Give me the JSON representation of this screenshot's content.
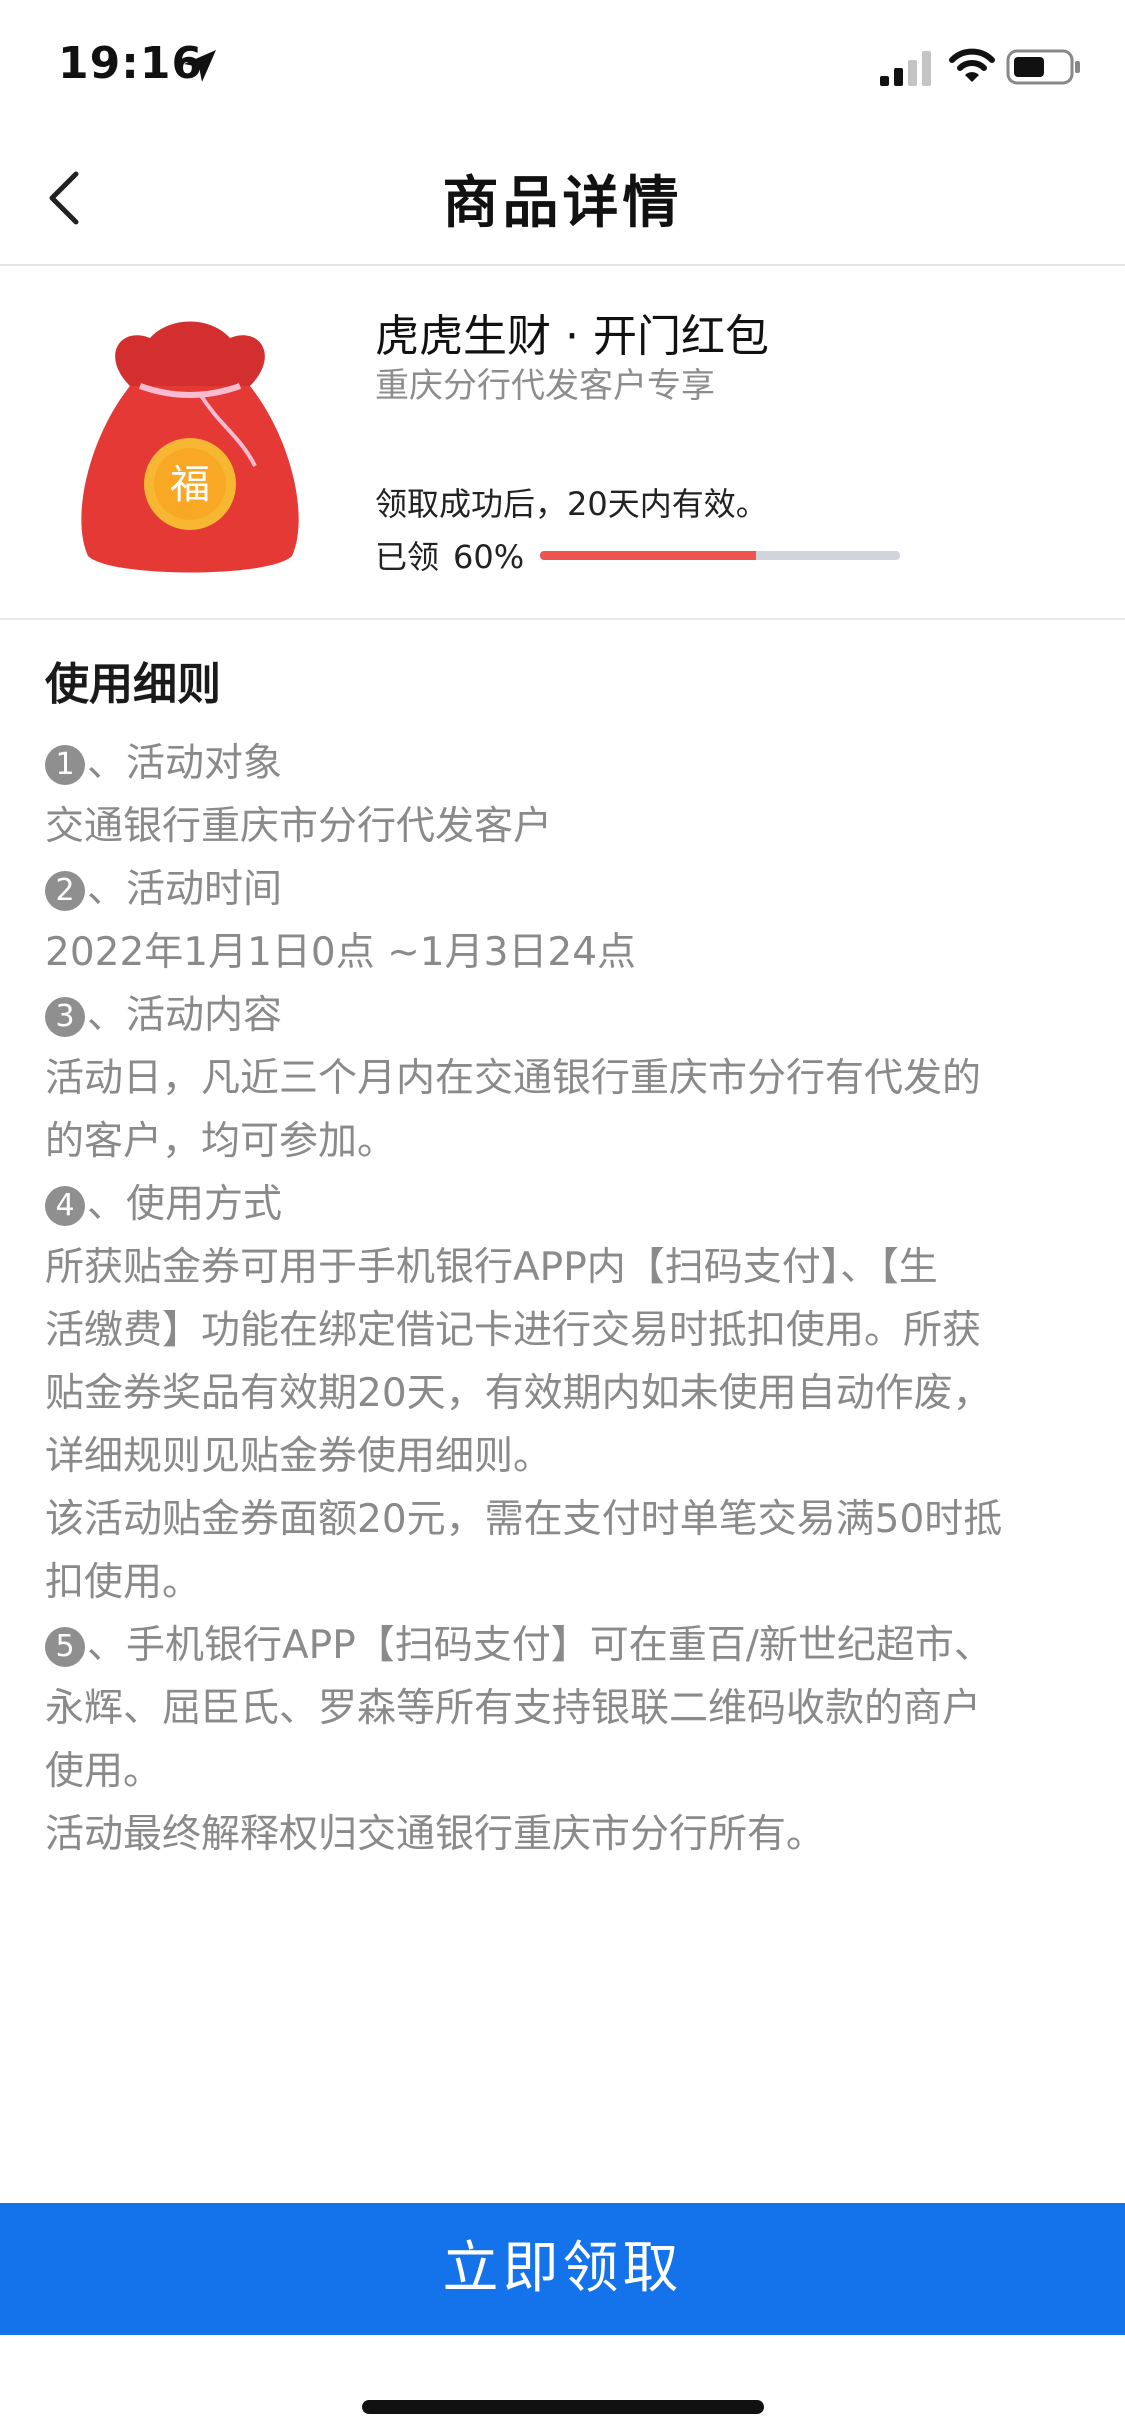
{
  "status_bar": {
    "time": "19:16"
  },
  "nav": {
    "title": "商品详情"
  },
  "product": {
    "name": "虎虎生财 · 开门红包",
    "subtitle": "重庆分行代发客户专享",
    "validity": "领取成功后，20天内有效。",
    "claimed_label": "已领",
    "claimed_percent_text": "60%",
    "claimed_fraction": 0.6,
    "bag_label": "福"
  },
  "rules": {
    "title": "使用细则",
    "lines": [
      "❶、活动对象",
      "交通银行重庆市分行代发客户",
      "❷、活动时间",
      "2022年1月1日0点 ~1月3日24点",
      "❸、活动内容",
      "活动日，凡近三个月内在交通银行重庆市分行有代发的",
      "的客户，均可参加。",
      "❹、使用方式",
      "所获贴金券可用于手机银行APP内【扫码支付】、【生",
      "活缴费】功能在绑定借记卡进行交易时抵扣使用。所获",
      "贴金券奖品有效期20天，有效期内如未使用自动作废，",
      "详细规则见贴金券使用细则。",
      "该活动贴金券面额20元，需在支付时单笔交易满50时抵",
      "扣使用。",
      "❺、手机银行APP【扫码支付】可在重百/新世纪超市、",
      "永辉、屈臣氏、罗森等所有支持银联二维码收款的商户",
      "使用。",
      "活动最终解释权归交通银行重庆市分行所有。"
    ]
  },
  "action": {
    "claim_label": "立即领取"
  },
  "colors": {
    "primary": "#1472ea",
    "progress": "#ef5350",
    "bag": "#e53935"
  },
  "icons": [
    "location-arrow-icon",
    "signal-icon",
    "wifi-icon",
    "battery-icon",
    "back-icon",
    "red-envelope-bag-icon"
  ]
}
